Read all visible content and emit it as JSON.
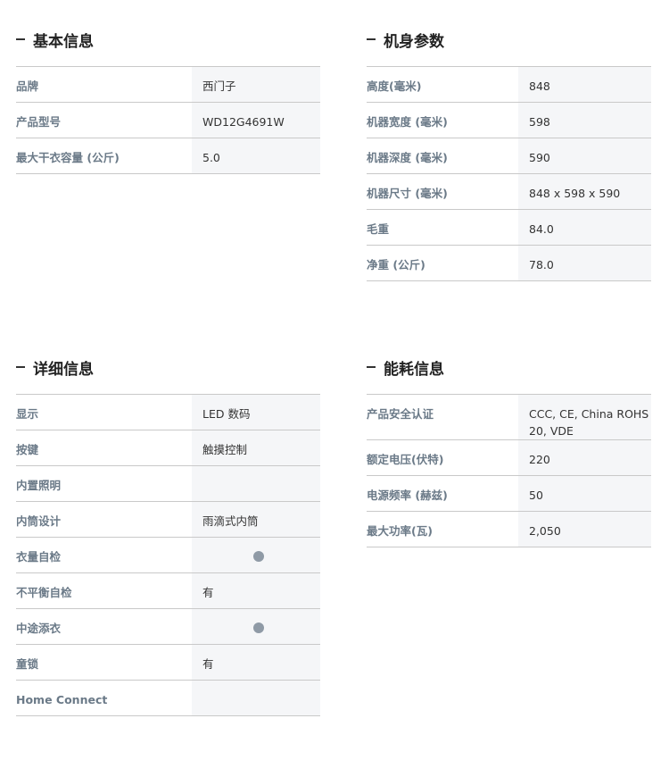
{
  "sections": {
    "basic": {
      "title": "基本信息",
      "rows": [
        {
          "label": "品牌",
          "value": "西门子"
        },
        {
          "label": "产品型号",
          "value": "WD12G4691W"
        },
        {
          "label": "最大干衣容量 (公斤)",
          "value": "5.0"
        }
      ]
    },
    "body": {
      "title": "机身参数",
      "rows": [
        {
          "label": "高度(毫米)",
          "value": "848"
        },
        {
          "label": "机器宽度 (毫米)",
          "value": "598"
        },
        {
          "label": "机器深度 (毫米)",
          "value": "590"
        },
        {
          "label": "机器尺寸 (毫米)",
          "value": "848 x 598 x 590"
        },
        {
          "label": "毛重",
          "value": "84.0"
        },
        {
          "label": "净重 (公斤)",
          "value": "78.0"
        }
      ]
    },
    "detail": {
      "title": "详细信息",
      "rows": [
        {
          "label": "显示",
          "value": "LED 数码"
        },
        {
          "label": "按键",
          "value": "触摸控制"
        },
        {
          "label": "内置照明",
          "value": ""
        },
        {
          "label": "内筒设计",
          "value": "雨滴式内筒"
        },
        {
          "label": "衣量自检",
          "value": "",
          "indicator": "dot"
        },
        {
          "label": "不平衡自检",
          "value": "有"
        },
        {
          "label": "中途添衣",
          "value": "",
          "indicator": "dot"
        },
        {
          "label": "童锁",
          "value": "有"
        },
        {
          "label": "Home Connect",
          "value": ""
        }
      ]
    },
    "energy": {
      "title": "能耗信息",
      "rows": [
        {
          "label": "产品安全认证",
          "value": "CCC, CE, China ROHS 20, VDE"
        },
        {
          "label": "额定电压(伏特)",
          "value": "220"
        },
        {
          "label": "电源频率 (赫兹)",
          "value": "50"
        },
        {
          "label": "最大功率(瓦)",
          "value": "2,050"
        }
      ]
    }
  },
  "colors": {
    "label": "#6b7a88",
    "value_bg": "#f5f6f8",
    "divider": "#c9c9c9",
    "indicator_dot": "#8f9aa6"
  }
}
